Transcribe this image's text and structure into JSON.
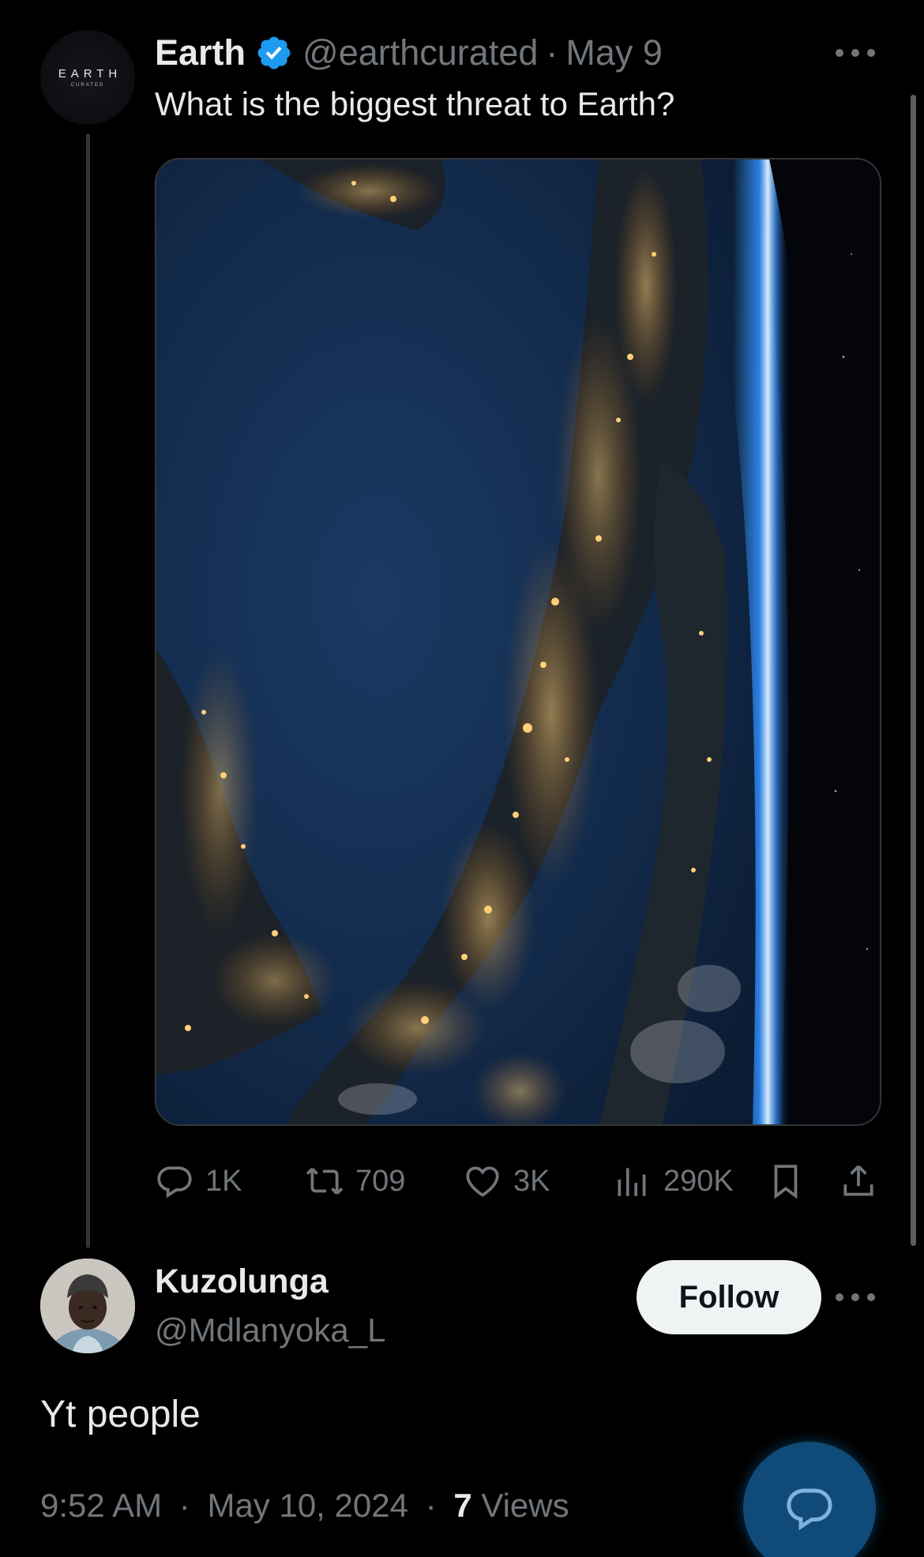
{
  "tweet": {
    "author_name": "Earth",
    "handle": "@earthcurated",
    "separator": "·",
    "date": "May 9",
    "text": "What is the biggest threat to Earth?",
    "avatar_logo": "EARTH",
    "avatar_logo_sub": "CURATED",
    "verified_icon": "verified-badge-icon",
    "media_description_icon": "earth-at-night-photo",
    "actions": {
      "replies": "1K",
      "retweets": "709",
      "likes": "3K",
      "views": "290K"
    }
  },
  "reply": {
    "author_name": "Kuzolunga",
    "handle": "@Mdlanyoka_L",
    "follow_label": "Follow",
    "text": "Yt people",
    "time": "9:52 AM",
    "date": "May 10, 2024",
    "views_count": "7",
    "views_label": "Views",
    "separator": "·"
  },
  "colors": {
    "background": "#000000",
    "primary_text": "#e7e9ea",
    "muted_text": "#71767b",
    "verified_blue": "#1d9bf0",
    "follow_bg": "#eff3f4",
    "fab_bg": "#0f4a78"
  }
}
